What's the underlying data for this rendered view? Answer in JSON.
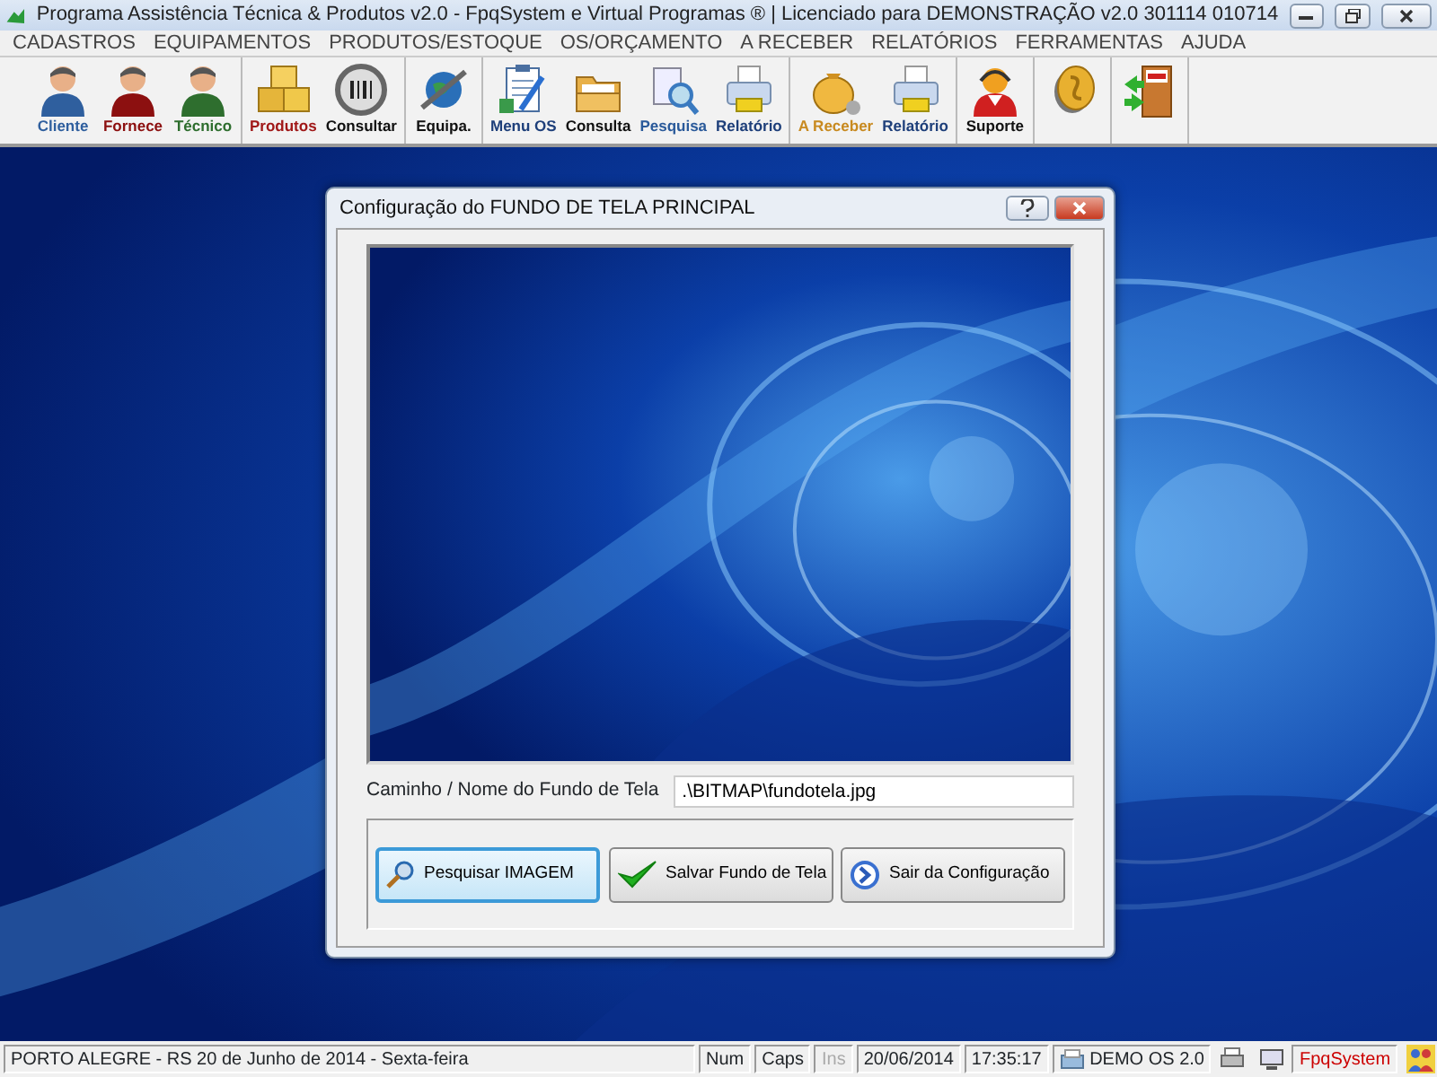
{
  "window": {
    "title": "Programa Assistência Técnica & Produtos v2.0 - FpqSystem e Virtual Programas ® | Licenciado para  DEMONSTRAÇÃO v2.0 301114 010714"
  },
  "menu": [
    "CADASTROS",
    "EQUIPAMENTOS",
    "PRODUTOS/ESTOQUE",
    "OS/ORÇAMENTO",
    "A RECEBER",
    "RELATÓRIOS",
    "FERRAMENTAS",
    "AJUDA"
  ],
  "toolbar": [
    {
      "items": [
        {
          "kind": "person",
          "label": "Cliente",
          "color": "#2f5f9e"
        },
        {
          "kind": "person",
          "label": "Fornece",
          "color": "#8c1010"
        },
        {
          "kind": "person",
          "label": "Técnico",
          "color": "#2e6e2e"
        }
      ]
    },
    {
      "items": [
        {
          "kind": "boxes",
          "label": "Produtos",
          "color": "#a01818"
        },
        {
          "kind": "barcode",
          "label": "Consultar",
          "color": "#111111"
        }
      ]
    },
    {
      "items": [
        {
          "kind": "globe",
          "label": "Equipa.",
          "color": "#111111"
        }
      ]
    },
    {
      "items": [
        {
          "kind": "clipboard",
          "label": "Menu OS",
          "color": "#1e3f7a"
        },
        {
          "kind": "folder",
          "label": "Consulta",
          "color": "#111111"
        },
        {
          "kind": "search",
          "label": "Pesquisa",
          "color": "#2a5a9a"
        },
        {
          "kind": "printer",
          "label": "Relatório",
          "color": "#1e3f7a"
        }
      ]
    },
    {
      "items": [
        {
          "kind": "money",
          "label": "A Receber",
          "color": "#c88a20"
        },
        {
          "kind": "printer",
          "label": "Relatório",
          "color": "#1e3f7a"
        }
      ]
    },
    {
      "items": [
        {
          "kind": "support",
          "label": "Suporte",
          "color": "#111111"
        }
      ]
    },
    {
      "items": [
        {
          "kind": "coin"
        }
      ]
    },
    {
      "items": [
        {
          "kind": "exit"
        }
      ]
    }
  ],
  "dialog": {
    "title": "Configuração do FUNDO DE TELA PRINCIPAL",
    "path_label": "Caminho / Nome do Fundo de Tela",
    "path_value": ".\\BITMAP\\fundotela.jpg",
    "buttons": [
      {
        "kind": "search",
        "label": "Pesquisar IMAGEM",
        "selected": true
      },
      {
        "kind": "check",
        "label": "Salvar Fundo de Tela",
        "selected": false
      },
      {
        "kind": "arrow",
        "label": "Sair da Configuração",
        "selected": false
      }
    ]
  },
  "status_bar": [
    {
      "kind": "text",
      "text": "PORTO ALEGRE - RS 20 de Junho de 2014 - Sexta-feira"
    },
    {
      "kind": "key",
      "text": "Num",
      "disabled": false
    },
    {
      "kind": "key",
      "text": "Caps",
      "disabled": false
    },
    {
      "kind": "key",
      "text": "Ins",
      "disabled": true
    },
    {
      "kind": "text",
      "text": "20/06/2014"
    },
    {
      "kind": "text",
      "text": "17:35:17"
    },
    {
      "kind": "app",
      "text": "DEMO OS 2.0"
    },
    {
      "kind": "printer"
    },
    {
      "kind": "monitor"
    },
    {
      "kind": "brand",
      "text": "FpqSystem"
    },
    {
      "kind": "people"
    }
  ]
}
